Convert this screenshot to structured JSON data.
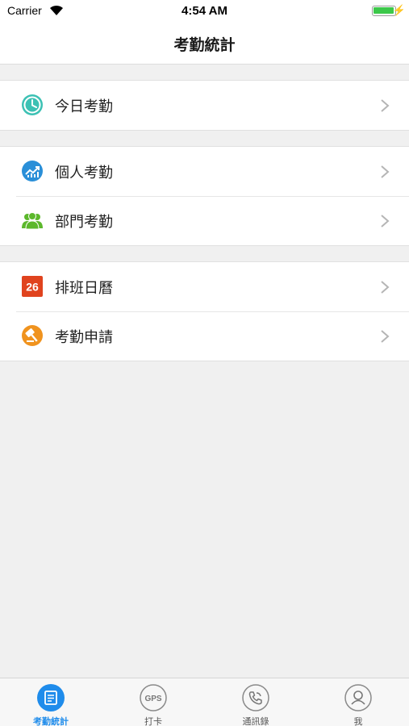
{
  "status_bar": {
    "carrier": "Carrier",
    "time": "4:54 AM",
    "battery_level": 1.0,
    "icons": [
      "wifi-icon",
      "battery-icon",
      "charging-icon"
    ]
  },
  "nav": {
    "title": "考勤統計"
  },
  "groups": [
    {
      "items": [
        {
          "label": "今日考勤",
          "icon": "clock-icon",
          "color": "#3cc1b4"
        }
      ]
    },
    {
      "items": [
        {
          "label": "個人考勤",
          "icon": "chart-icon",
          "color": "#2a8fd8"
        },
        {
          "label": "部門考勤",
          "icon": "people-icon",
          "color": "#5cb82c"
        }
      ]
    },
    {
      "items": [
        {
          "label": "排班日曆",
          "icon": "calendar-icon",
          "color": "#e0431e",
          "badge": "26"
        },
        {
          "label": "考勤申請",
          "icon": "gavel-icon",
          "color": "#f0931e"
        }
      ]
    }
  ],
  "tabs": [
    {
      "label": "考勤統計",
      "icon": "attendance-icon",
      "active": true
    },
    {
      "label": "打卡",
      "icon": "gps-icon",
      "active": false,
      "icon_text": "GPS"
    },
    {
      "label": "通訊錄",
      "icon": "phone-icon",
      "active": false
    },
    {
      "label": "我",
      "icon": "profile-icon",
      "active": false
    }
  ],
  "colors": {
    "accent": "#1f8ceb",
    "background": "#f0f0f0",
    "chevron": "#b5b5b5"
  }
}
